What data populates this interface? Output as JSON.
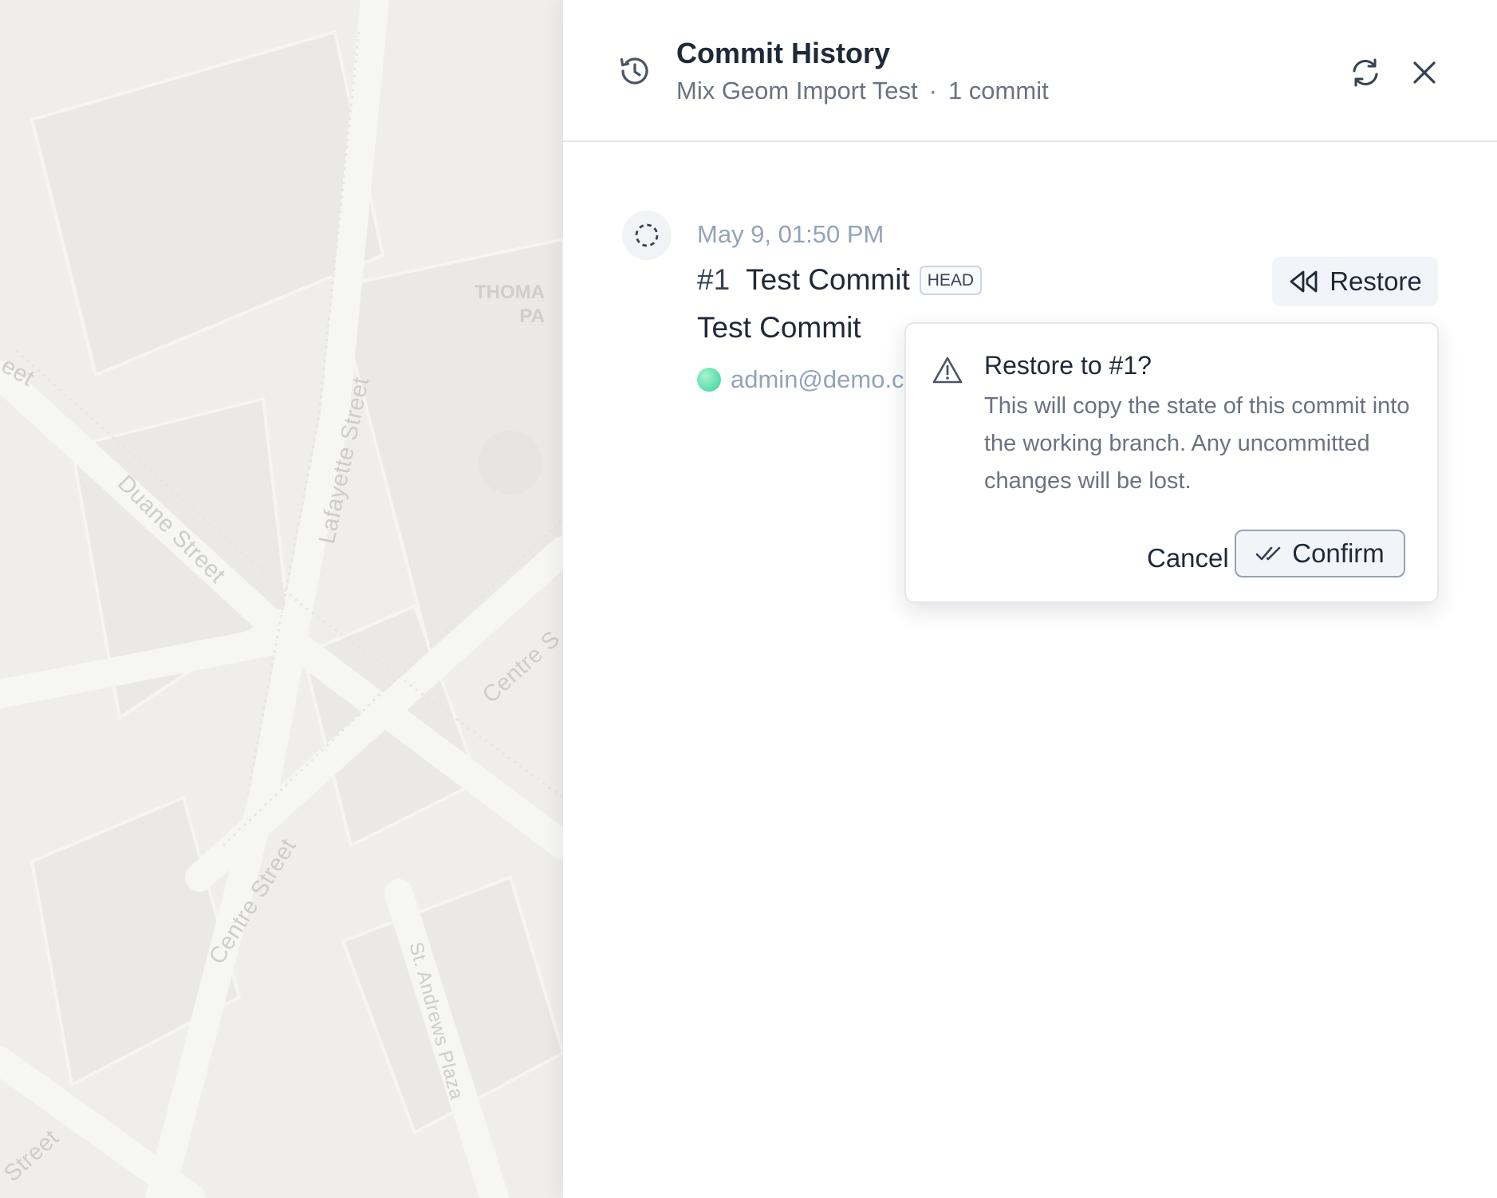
{
  "map": {
    "streets": [
      "Duane Street",
      "Lafayette Street",
      "Centre Street",
      "Centre S",
      "St. Andrews Plaza",
      "Street",
      "eet"
    ],
    "place": [
      "THOMA",
      "PA"
    ]
  },
  "panel": {
    "title": "Commit History",
    "project": "Mix Geom Import Test",
    "separator": "·",
    "count": "1 commit",
    "refresh_tooltip": "Refresh",
    "close_tooltip": "Close"
  },
  "commit": {
    "date": "May 9, 01:50 PM",
    "number": "#1",
    "title": "Test Commit",
    "badge": "HEAD",
    "message": "Test Commit",
    "author": "admin@demo.co",
    "restore_label": "Restore"
  },
  "popover": {
    "title": "Restore to #1?",
    "body": "This will copy the state of this commit into the working branch. Any uncommitted changes will be lost.",
    "cancel_label": "Cancel",
    "confirm_label": "Confirm"
  },
  "colors": {
    "map_bg": "#f0efec",
    "text_primary": "#1f2937",
    "text_muted": "#6b7280",
    "avatar": "#34d399"
  }
}
